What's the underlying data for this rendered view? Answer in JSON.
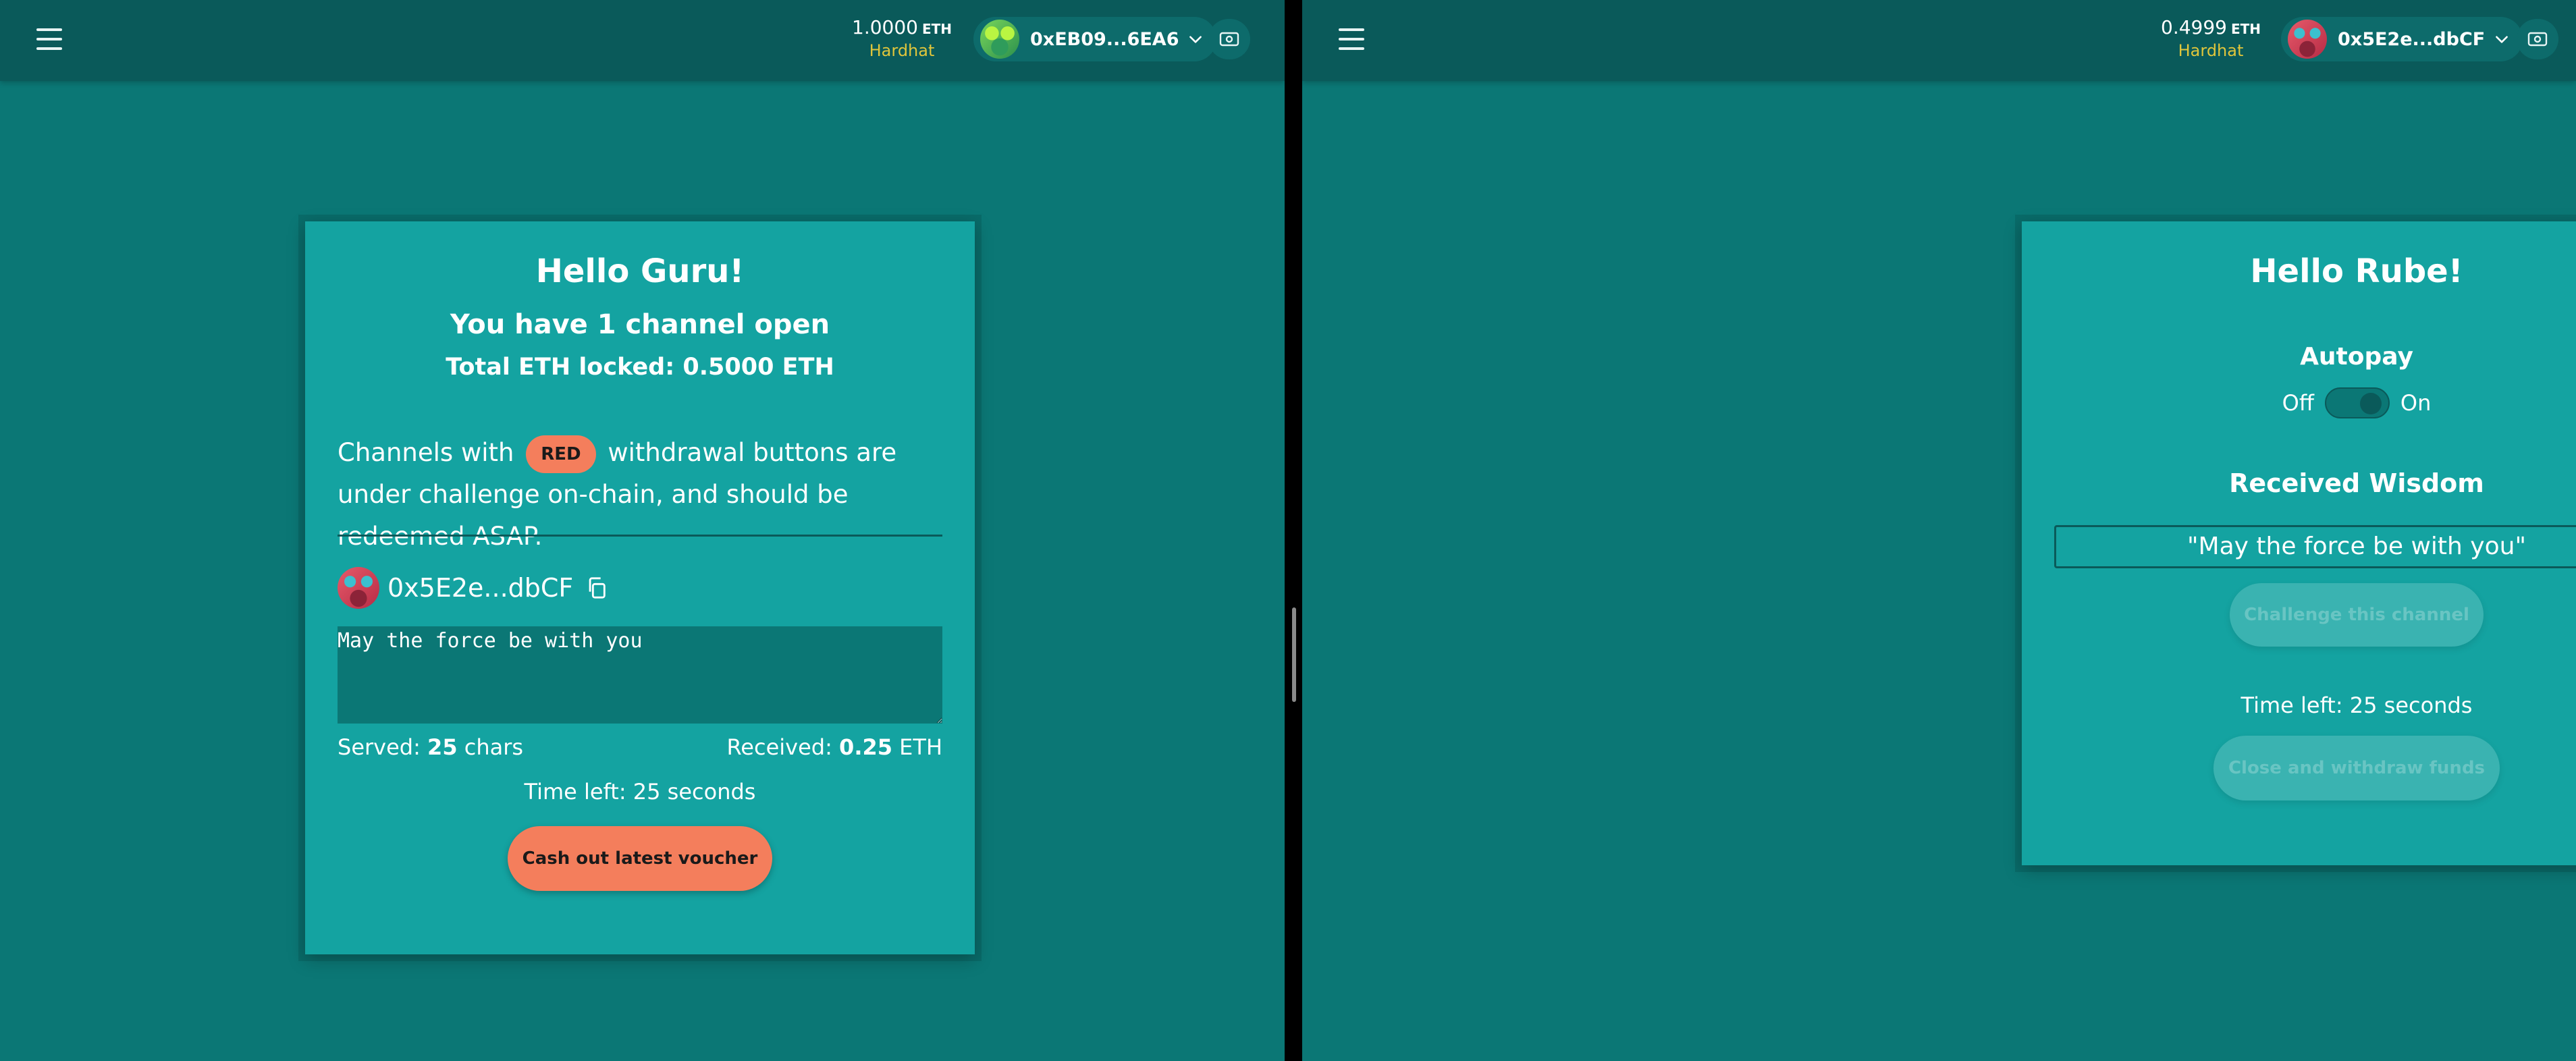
{
  "left": {
    "header": {
      "balance_value": "1.0000",
      "balance_unit": "ETH",
      "network": "Hardhat",
      "account": "0xEB09...6EA6"
    },
    "card": {
      "title": "Hello Guru!",
      "channels_open": "You have 1 channel open",
      "total_locked": "Total ETH locked: 0.5000 ETH",
      "warning_before": "Channels with",
      "warning_badge": "RED",
      "warning_after": "withdrawal buttons are under challenge on-chain, and should be redeemed ASAP.",
      "peer_address": "0x5E2e...dbCF",
      "wisdom_text": "May the force be with you",
      "served_label": "Served:",
      "served_value": "25",
      "served_unit": "chars",
      "received_label": "Received:",
      "received_value": "0.25",
      "received_unit": "ETH",
      "time_left": "Time left: 25 seconds",
      "cashout_label": "Cash out latest voucher"
    }
  },
  "right": {
    "header": {
      "balance_value": "0.4999",
      "balance_unit": "ETH",
      "network": "Hardhat",
      "account": "0x5E2e...dbCF"
    },
    "card": {
      "title": "Hello Rube!",
      "autopay_label": "Autopay",
      "toggle_off": "Off",
      "toggle_on": "On",
      "received_wisdom_label": "Received Wisdom",
      "received_wisdom": "\"May the force be with you\"",
      "challenge_label": "Challenge this channel",
      "time_left": "Time left: 25 seconds",
      "close_label": "Close and withdraw funds"
    }
  },
  "colors": {
    "background": "#0b7775",
    "topbar": "#0a5a5a",
    "card": "#14a3a1",
    "accent": "#f47e5c",
    "network": "#e0c53b"
  },
  "icons": [
    "hamburger-menu-icon",
    "chevron-down-icon",
    "wallet-icon",
    "copy-icon"
  ]
}
